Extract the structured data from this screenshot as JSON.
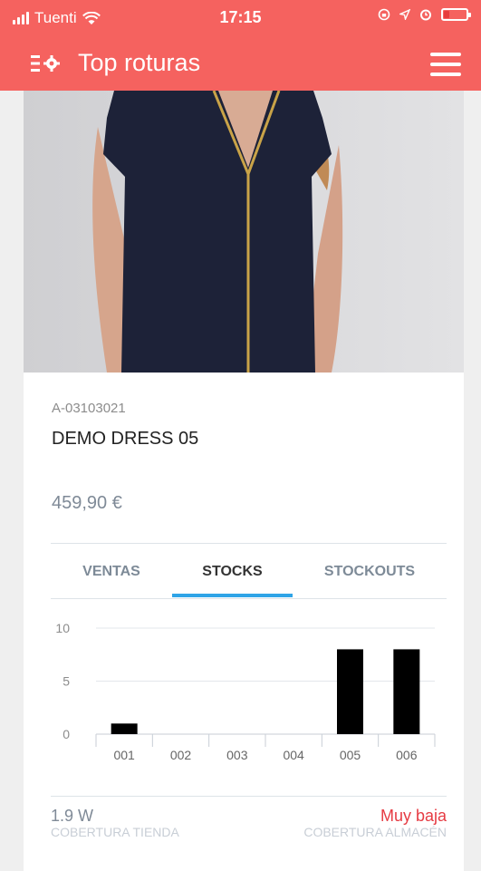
{
  "status_bar": {
    "carrier": "Tuenti",
    "time": "17:15",
    "icons": [
      "signal-icon",
      "wifi-icon",
      "lock-rotation-icon",
      "location-icon",
      "alarm-icon",
      "battery-icon"
    ]
  },
  "app_bar": {
    "title": "Top roturas",
    "color": "#f5625f",
    "left_icon": "filter-settings-icon",
    "right_icon": "hamburger-menu-icon"
  },
  "product": {
    "reference": "A-03103021",
    "name": "DEMO DRESS 05",
    "price": "459,90 €",
    "image": "navy-dress-photo"
  },
  "tabs": [
    {
      "label": "VENTAS",
      "active": false
    },
    {
      "label": "STOCKS",
      "active": true
    },
    {
      "label": "STOCKOUTS",
      "active": false
    }
  ],
  "chart_data": {
    "type": "bar",
    "categories": [
      "001",
      "002",
      "003",
      "004",
      "005",
      "006"
    ],
    "values": [
      1,
      0,
      0,
      0,
      8,
      8
    ],
    "ylim": [
      0,
      10
    ],
    "yticks": [
      0,
      5,
      10
    ],
    "grid": true,
    "bar_color": "#000000"
  },
  "coverage": {
    "store_value": "1.9 W",
    "store_label": "COBERTURA TIENDA",
    "warehouse_value": "Muy baja",
    "warehouse_label": "COBERTURA ALMACÉN",
    "warehouse_color": "#e63b43"
  }
}
